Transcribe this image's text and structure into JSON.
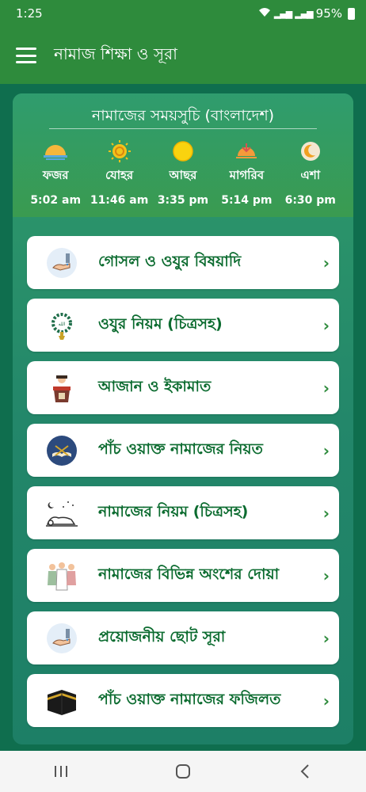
{
  "status": {
    "time": "1:25",
    "battery": "95%"
  },
  "app": {
    "title": "নামাজ শিক্ষা ও সূরা"
  },
  "prayer_times": {
    "title": "নামাজের সময়সুচি (বাংলাদেশ)",
    "items": [
      {
        "name": "ফজর",
        "time": "5:02 am",
        "icon": "sunrise-icon"
      },
      {
        "name": "যোহর",
        "time": "11:46 am",
        "icon": "sun-noon-icon"
      },
      {
        "name": "আছর",
        "time": "3:35 pm",
        "icon": "sun-afternoon-icon"
      },
      {
        "name": "মাগরিব",
        "time": "5:14 pm",
        "icon": "sunset-icon"
      },
      {
        "name": "এশা",
        "time": "6:30 pm",
        "icon": "moon-icon"
      }
    ]
  },
  "menu": [
    {
      "label": "গোসল ও ওযুর বিষয়াদি",
      "icon": "wudu-hand-icon"
    },
    {
      "label": "ওযুর নিয়ম (চিত্রসহ)",
      "icon": "tasbih-icon"
    },
    {
      "label": "আজান ও ইকামাত",
      "icon": "imam-pulpit-icon"
    },
    {
      "label": "পাঁচ ওয়াক্ত নামাজের নিয়ত",
      "icon": "quran-icon"
    },
    {
      "label": "নামাজের নিয়ম (চিত্রসহ)",
      "icon": "sujood-icon"
    },
    {
      "label": "নামাজের বিভিন্ন অংশের দোয়া",
      "icon": "praying-people-icon"
    },
    {
      "label": "প্রয়োজনীয় ছোট সূরা",
      "icon": "dua-hands-icon"
    },
    {
      "label": "পাঁচ ওয়াক্ত নামাজের ফজিলত",
      "icon": "kaaba-icon"
    }
  ],
  "colors": {
    "primary": "#2e8b3c",
    "background": "#0f6e4e",
    "item_text": "#0b6b2f"
  }
}
